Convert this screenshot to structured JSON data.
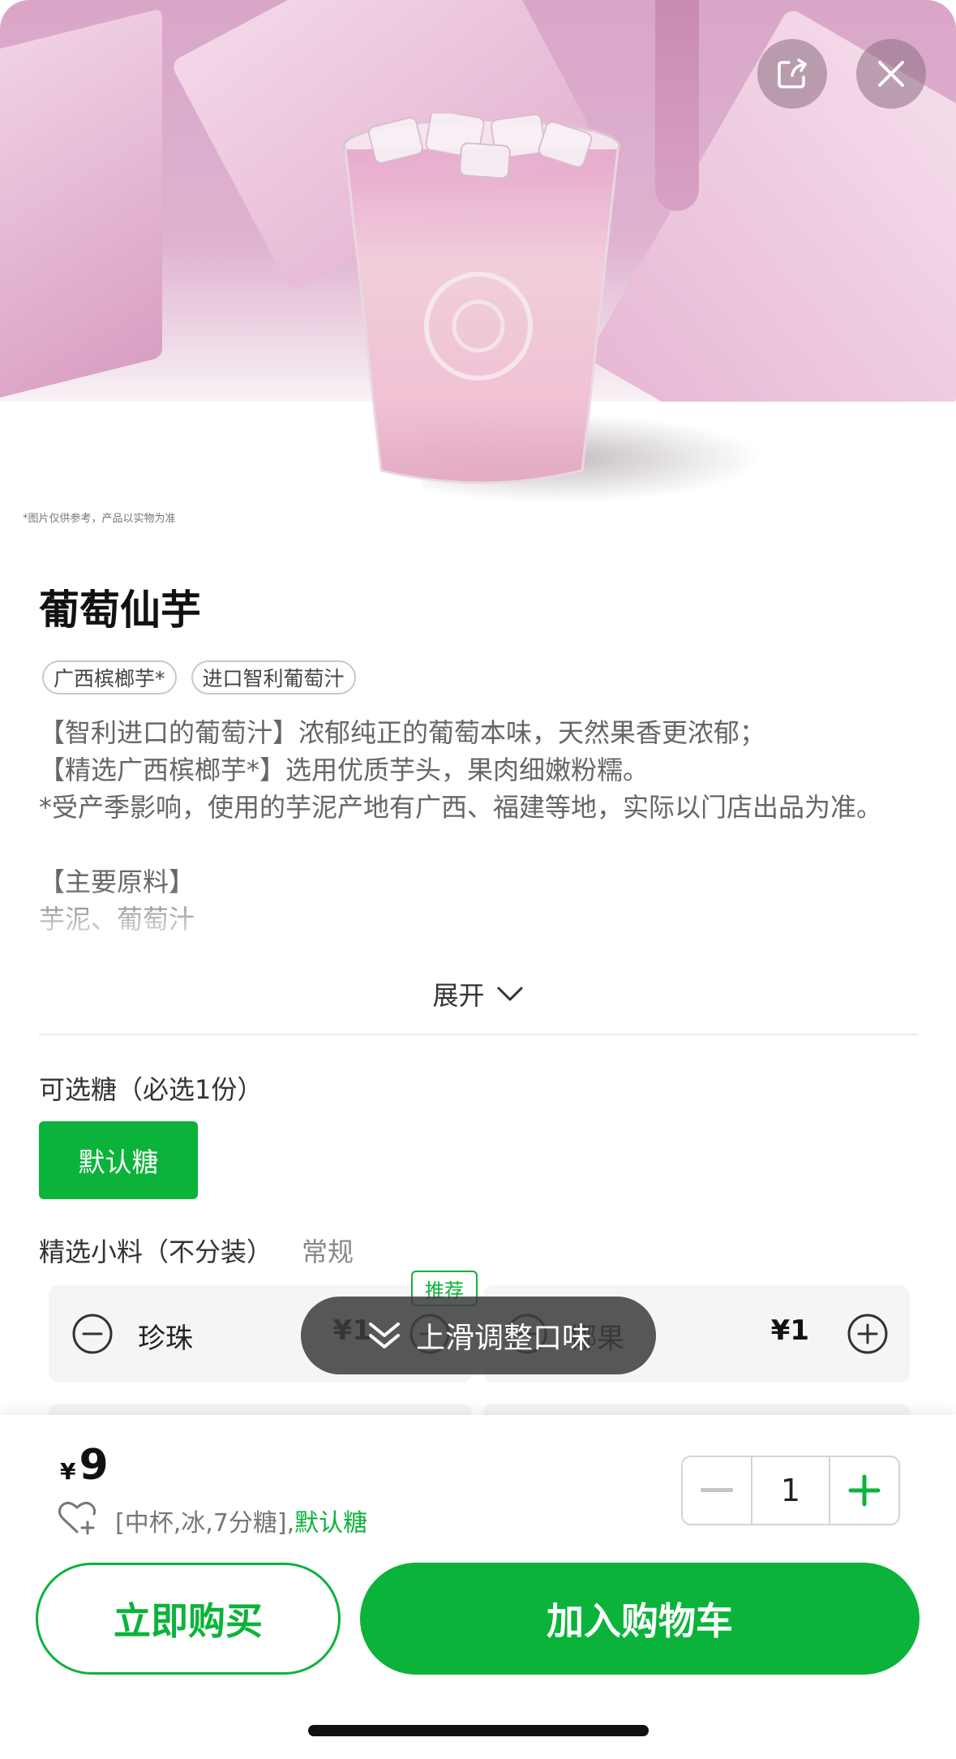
{
  "header": {
    "share_icon": "share-icon",
    "close_icon": "close-icon",
    "image_note": "*图片仅供参考，产品以实物为准"
  },
  "product": {
    "name": "葡萄仙芋",
    "tags": [
      "广西槟榔芋*",
      "进口智利葡萄汁"
    ],
    "description": "【智利进口的葡萄汁】浓郁纯正的葡萄本味，天然果香更浓郁；\n【精选广西槟榔芋*】选用优质芋头，果肉细嫩粉糯。\n*受产季影响，使用的芋泥产地有广西、福建等地，实际以门店出品为准。\n\n【主要原料】\n芋泥、葡萄汁",
    "expand_label": "展开"
  },
  "options": {
    "sugar_label": "可选糖（必选1份）",
    "sugar_selected": "默认糖",
    "topping_label": "精选小料（不分装）",
    "topping_sub": "常规",
    "recommend_badge": "推荐",
    "toppings": [
      {
        "name": "珍珠",
        "price": "¥1"
      },
      {
        "name": "椰果",
        "price": "¥1"
      }
    ]
  },
  "toast": {
    "text": "上滑调整口味"
  },
  "footer": {
    "currency": "¥",
    "price": "9",
    "spec_text": "[中杯,冰,7分糖],",
    "spec_sugar": "默认糖",
    "quantity": "1",
    "buy_now_label": "立即购买",
    "add_cart_label": "加入购物车"
  },
  "colors": {
    "brand_green": "#0bb33a"
  }
}
